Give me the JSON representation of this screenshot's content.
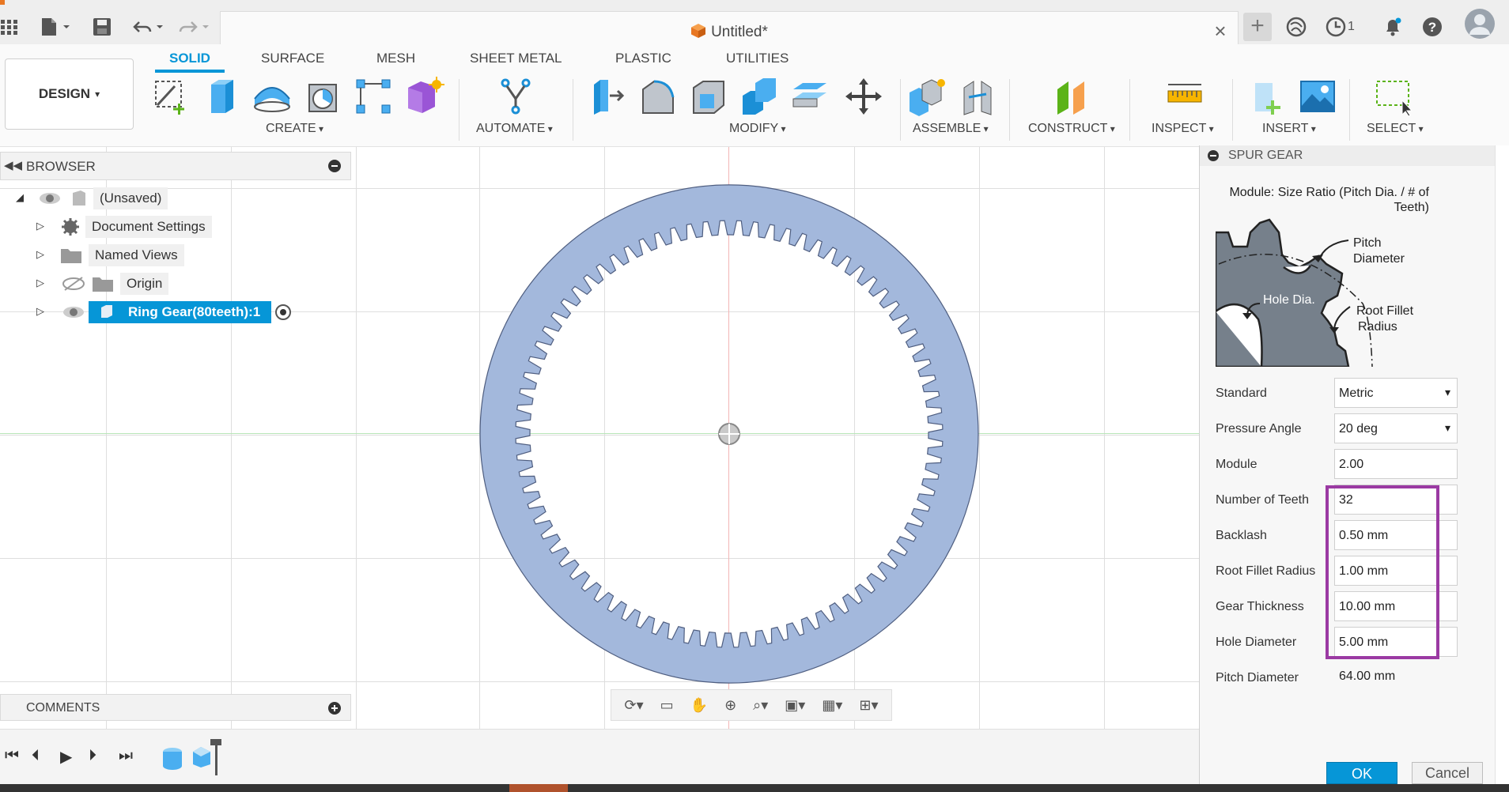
{
  "window": {
    "document_title": "Untitled*",
    "notifications_count": "1"
  },
  "ribbon": {
    "workspace_label": "DESIGN",
    "tabs": [
      "SOLID",
      "SURFACE",
      "MESH",
      "SHEET METAL",
      "PLASTIC",
      "UTILITIES"
    ],
    "active_tab": "SOLID",
    "groups": [
      "CREATE",
      "AUTOMATE",
      "MODIFY",
      "ASSEMBLE",
      "CONSTRUCT",
      "INSPECT",
      "INSERT",
      "SELECT"
    ]
  },
  "browser": {
    "title": "BROWSER",
    "items": [
      {
        "label": "(Unsaved)"
      },
      {
        "label": "Document Settings"
      },
      {
        "label": "Named Views"
      },
      {
        "label": "Origin"
      },
      {
        "label": "Ring Gear(80teeth):1"
      }
    ]
  },
  "comments": {
    "title": "COMMENTS"
  },
  "model": {
    "gear_teeth": 80,
    "gear_color": "#a3b8dc"
  },
  "dialog": {
    "title": "SPUR GEAR",
    "diagram_caption": "Module: Size Ratio (Pitch Dia. / # of Teeth)",
    "diagram_labels": {
      "pitch": "Pitch",
      "diameter": "Diameter",
      "hole_dia": "Hole Dia.",
      "root_fillet": "Root Fillet",
      "radius": "Radius"
    },
    "params": {
      "standard": {
        "label": "Standard",
        "value": "Metric"
      },
      "pressure_angle": {
        "label": "Pressure Angle",
        "value": "20 deg"
      },
      "module": {
        "label": "Module",
        "value": "2.00"
      },
      "teeth": {
        "label": "Number of Teeth",
        "value": "32"
      },
      "backlash": {
        "label": "Backlash",
        "value": "0.50 mm"
      },
      "root_fillet": {
        "label": "Root Fillet Radius",
        "value": "1.00 mm"
      },
      "thickness": {
        "label": "Gear Thickness",
        "value": "10.00 mm"
      },
      "hole_diameter": {
        "label": "Hole Diameter",
        "value": "5.00 mm"
      },
      "pitch_diameter": {
        "label": "Pitch Diameter",
        "value": "64.00 mm"
      }
    },
    "ok_label": "OK",
    "cancel_label": "Cancel"
  },
  "colors": {
    "accent": "#0696d7",
    "highlight": "#9b3aa3"
  }
}
